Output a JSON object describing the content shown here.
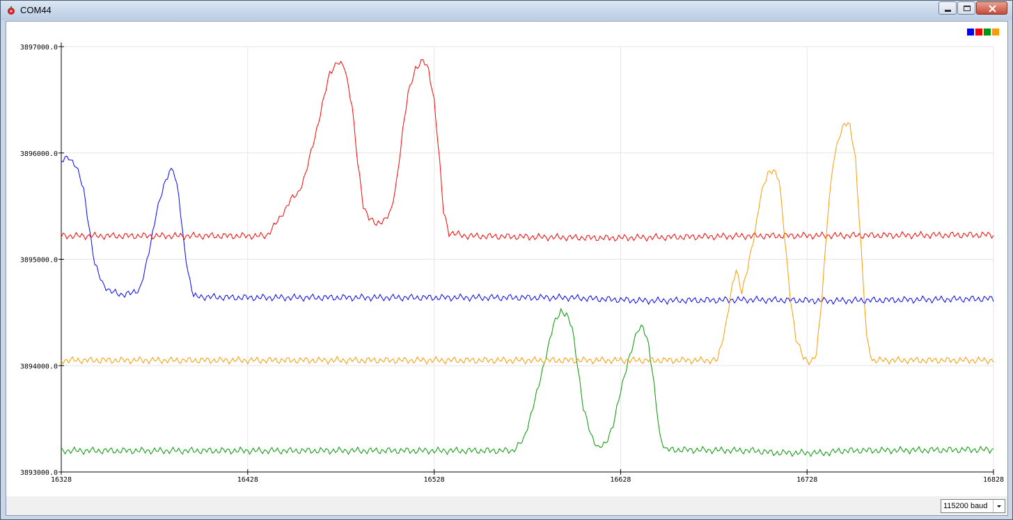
{
  "window": {
    "title": "COM44",
    "app_icon": "arduino-icon",
    "controls": [
      "minimize-icon",
      "maximize-icon",
      "close-icon"
    ]
  },
  "statusbar": {
    "baud_value": "115200 baud"
  },
  "chart_data": {
    "type": "line",
    "title": "",
    "xlabel": "",
    "ylabel": "",
    "xlim": [
      16328,
      16828
    ],
    "ylim": [
      3893000,
      3897000
    ],
    "x_ticks": [
      16328,
      16428,
      16528,
      16628,
      16728,
      16828
    ],
    "x_tick_labels": [
      "16328",
      "16428",
      "16528",
      "16628",
      "16728",
      "16828"
    ],
    "y_ticks": [
      3893000,
      3894000,
      3895000,
      3896000,
      3897000
    ],
    "y_tick_labels": [
      "3893000.0",
      "3894000.0",
      "3895000.0",
      "3896000.0",
      "3897000.0"
    ],
    "grid": true,
    "legend_position": "top-right",
    "noise_amplitude": 35,
    "series": [
      {
        "color": "#0000ff",
        "keypoints": [
          [
            16328,
            3895920
          ],
          [
            16332,
            3895960
          ],
          [
            16336,
            3895880
          ],
          [
            16340,
            3895650
          ],
          [
            16343,
            3895300
          ],
          [
            16346,
            3894950
          ],
          [
            16350,
            3894780
          ],
          [
            16354,
            3894700
          ],
          [
            16360,
            3894670
          ],
          [
            16366,
            3894680
          ],
          [
            16370,
            3894720
          ],
          [
            16373,
            3894900
          ],
          [
            16376,
            3895150
          ],
          [
            16379,
            3895450
          ],
          [
            16383,
            3895680
          ],
          [
            16386,
            3895830
          ],
          [
            16388,
            3895860
          ],
          [
            16391,
            3895600
          ],
          [
            16393,
            3895250
          ],
          [
            16396,
            3894880
          ],
          [
            16399,
            3894650
          ],
          [
            16420,
            3894640
          ],
          [
            16500,
            3894640
          ],
          [
            16600,
            3894640
          ],
          [
            16640,
            3894610
          ],
          [
            16700,
            3894620
          ],
          [
            16740,
            3894610
          ],
          [
            16828,
            3894630
          ]
        ]
      },
      {
        "color": "#ff0000",
        "keypoints": [
          [
            16328,
            3895220
          ],
          [
            16438,
            3895220
          ],
          [
            16445,
            3895380
          ],
          [
            16451,
            3895560
          ],
          [
            16455,
            3895620
          ],
          [
            16459,
            3895800
          ],
          [
            16464,
            3896150
          ],
          [
            16468,
            3896450
          ],
          [
            16472,
            3896750
          ],
          [
            16476,
            3896860
          ],
          [
            16480,
            3896800
          ],
          [
            16484,
            3896450
          ],
          [
            16487,
            3895900
          ],
          [
            16490,
            3895500
          ],
          [
            16493,
            3895400
          ],
          [
            16497,
            3895320
          ],
          [
            16502,
            3895390
          ],
          [
            16505,
            3895450
          ],
          [
            16508,
            3895750
          ],
          [
            16511,
            3896200
          ],
          [
            16514,
            3896550
          ],
          [
            16518,
            3896800
          ],
          [
            16522,
            3896870
          ],
          [
            16525,
            3896780
          ],
          [
            16528,
            3896500
          ],
          [
            16531,
            3895900
          ],
          [
            16533,
            3895450
          ],
          [
            16536,
            3895250
          ],
          [
            16545,
            3895220
          ],
          [
            16620,
            3895200
          ],
          [
            16700,
            3895220
          ],
          [
            16828,
            3895230
          ]
        ]
      },
      {
        "color": "#009900",
        "keypoints": [
          [
            16328,
            3893200
          ],
          [
            16570,
            3893200
          ],
          [
            16576,
            3893300
          ],
          [
            16580,
            3893550
          ],
          [
            16584,
            3893800
          ],
          [
            16588,
            3894100
          ],
          [
            16592,
            3894380
          ],
          [
            16596,
            3894520
          ],
          [
            16599,
            3894480
          ],
          [
            16602,
            3894350
          ],
          [
            16605,
            3894000
          ],
          [
            16608,
            3893600
          ],
          [
            16612,
            3893350
          ],
          [
            16616,
            3893230
          ],
          [
            16620,
            3893260
          ],
          [
            16624,
            3893450
          ],
          [
            16628,
            3893750
          ],
          [
            16632,
            3894050
          ],
          [
            16637,
            3894320
          ],
          [
            16640,
            3894380
          ],
          [
            16643,
            3894200
          ],
          [
            16646,
            3893800
          ],
          [
            16649,
            3893350
          ],
          [
            16652,
            3893210
          ],
          [
            16700,
            3893200
          ],
          [
            16710,
            3893180
          ],
          [
            16740,
            3893180
          ],
          [
            16745,
            3893200
          ],
          [
            16828,
            3893210
          ]
        ]
      },
      {
        "color": "#ff9900",
        "keypoints": [
          [
            16328,
            3894050
          ],
          [
            16680,
            3894050
          ],
          [
            16684,
            3894350
          ],
          [
            16688,
            3894750
          ],
          [
            16690,
            3894900
          ],
          [
            16693,
            3894700
          ],
          [
            16696,
            3894900
          ],
          [
            16700,
            3895250
          ],
          [
            16703,
            3895600
          ],
          [
            16707,
            3895800
          ],
          [
            16710,
            3895850
          ],
          [
            16713,
            3895750
          ],
          [
            16716,
            3895200
          ],
          [
            16719,
            3894650
          ],
          [
            16722,
            3894250
          ],
          [
            16726,
            3894080
          ],
          [
            16730,
            3894030
          ],
          [
            16733,
            3894100
          ],
          [
            16736,
            3894650
          ],
          [
            16739,
            3895400
          ],
          [
            16742,
            3895900
          ],
          [
            16745,
            3896150
          ],
          [
            16748,
            3896280
          ],
          [
            16751,
            3896250
          ],
          [
            16754,
            3895950
          ],
          [
            16757,
            3895100
          ],
          [
            16760,
            3894250
          ],
          [
            16763,
            3894050
          ],
          [
            16828,
            3894050
          ]
        ]
      }
    ]
  }
}
